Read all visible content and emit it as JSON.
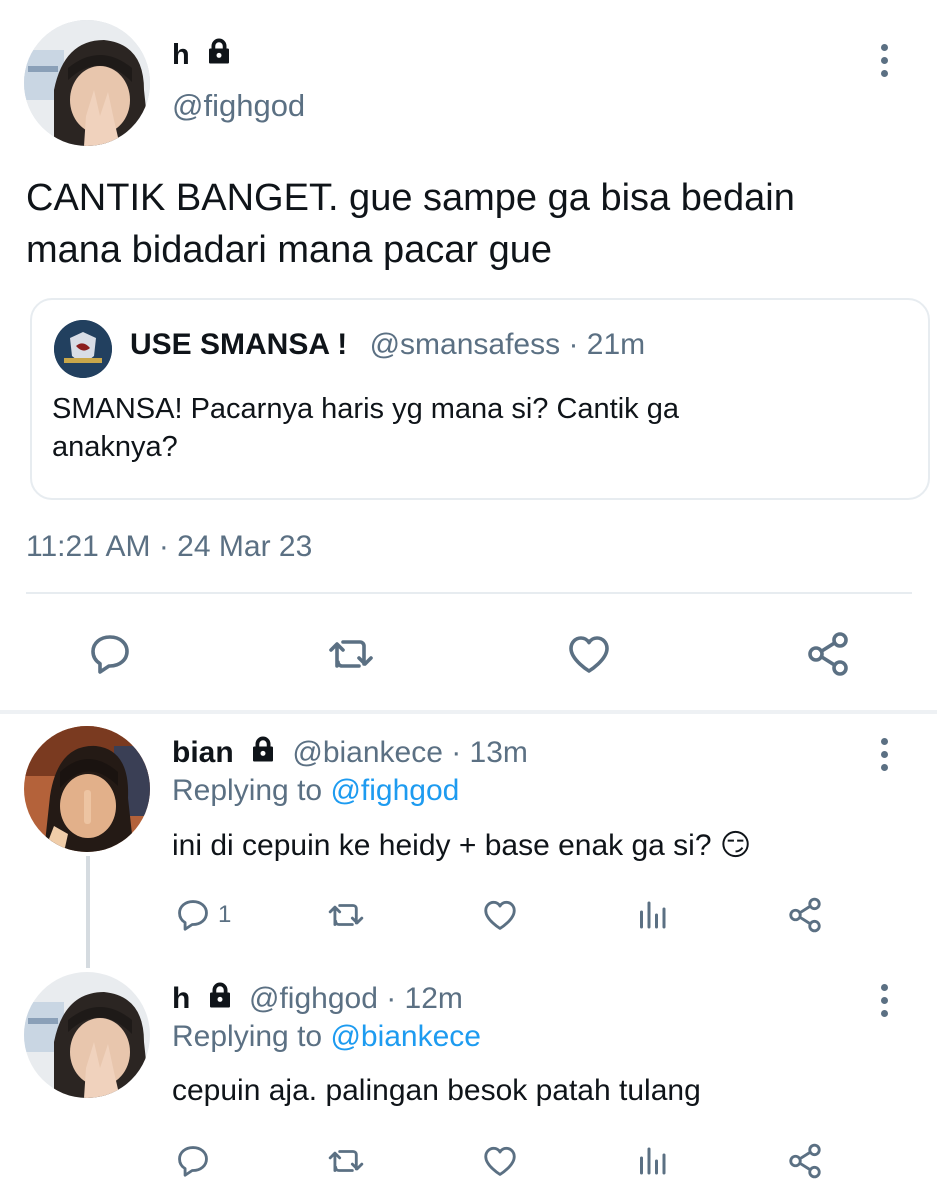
{
  "main_tweet": {
    "display_name": "h",
    "handle": "@fighgod",
    "text_line1": "CANTIK BANGET. gue sampe ga bisa bedain",
    "text_line2": "mana bidadari mana pacar gue",
    "quote": {
      "display_name": "USE SMANSA !",
      "handle_time": "@smansafess · 21m",
      "text_line1": "SMANSA! Pacarnya haris yg mana si? Cantik ga",
      "text_line2": "anaknya?"
    },
    "timestamp": "11:21 AM · 24 Mar 23"
  },
  "replies": [
    {
      "display_name": "bian",
      "handle_time": "@biankece · 13m",
      "replying_prefix": "Replying to ",
      "replying_to": "@fighgod",
      "text": "ini di cepuin ke heidy + base enak ga si? 😏",
      "reply_count": "1"
    },
    {
      "display_name": "h",
      "handle_time": "@fighgod · 12m",
      "replying_prefix": "Replying to ",
      "replying_to": "@biankece",
      "text": "cepuin aja. palingan besok patah tulang",
      "reply_count": ""
    }
  ],
  "icons": {
    "lock": "lock-icon",
    "more": "more-vertical-icon",
    "reply": "reply-icon",
    "retweet": "retweet-icon",
    "like": "like-icon",
    "share": "share-icon",
    "views": "views-icon"
  },
  "colors": {
    "text": "#0f1419",
    "muted": "#5b7083",
    "link": "#1d9bf0",
    "border": "#e7ecf0"
  }
}
